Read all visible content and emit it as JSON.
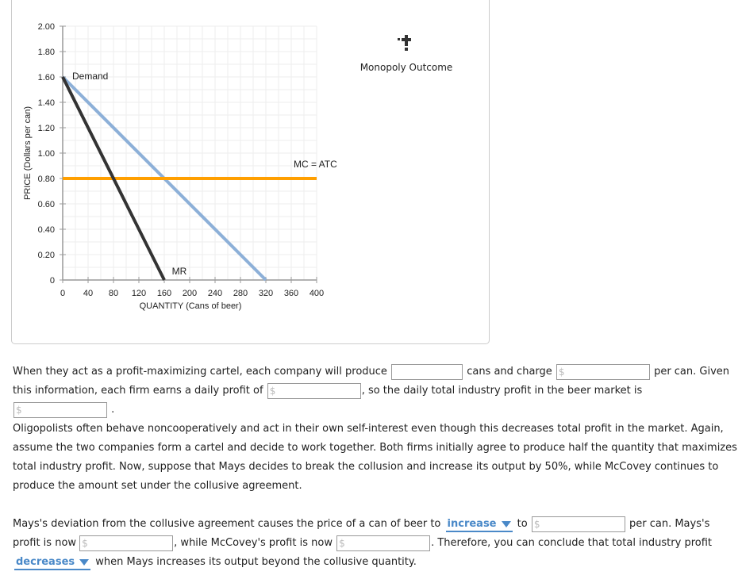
{
  "chart_data": {
    "type": "line",
    "xlabel": "QUANTITY (Cans of beer)",
    "ylabel": "PRICE (Dollars per can)",
    "xlim": [
      0,
      400
    ],
    "ylim": [
      0,
      2.0
    ],
    "xticks": [
      "0",
      "40",
      "80",
      "120",
      "160",
      "200",
      "240",
      "280",
      "320",
      "360",
      "400"
    ],
    "yticks": [
      "0",
      "0.20",
      "0.40",
      "0.60",
      "0.80",
      "1.00",
      "1.20",
      "1.40",
      "1.60",
      "1.80",
      "2.00"
    ],
    "grid": true,
    "series": [
      {
        "name": "Demand",
        "color": "#8db0d8",
        "points": [
          [
            0,
            1.6
          ],
          [
            320,
            0
          ]
        ]
      },
      {
        "name": "MR",
        "color": "#333333",
        "points": [
          [
            0,
            1.6
          ],
          [
            160,
            0
          ]
        ]
      },
      {
        "name": "MC = ATC",
        "color": "#ff9f00",
        "points": [
          [
            0,
            0.8
          ],
          [
            400,
            0.8
          ]
        ]
      }
    ],
    "legend": {
      "label": "Monopoly Outcome",
      "icon": "plus-marker-icon",
      "placement": "right"
    }
  },
  "q1": {
    "t1": "When they act as a profit-maximizing cartel, each company will produce",
    "t2": "cans and charge",
    "t3": "per can. Given this information, each firm earns a daily profit of",
    "t4": ", so the daily total industry profit in the beer market is",
    "t5": ".",
    "dollar": "$"
  },
  "q2": "Oligopolists often behave noncooperatively and act in their own self-interest even though this decreases total profit in the market. Again, assume the two companies form a cartel and decide to work together. Both firms initially agree to produce half the quantity that maximizes total industry profit. Now, suppose that Mays decides to break the collusion and increase its output by 50%, while McCovey continues to produce the amount set under the collusive agreement.",
  "q3": {
    "t1": "Mays's deviation from the collusive agreement causes the price of a can of beer to",
    "sel1": "increase",
    "t2": "to",
    "t3": "per can. Mays's profit is now",
    "t4": ", while McCovey's profit is now",
    "t5": ". Therefore, you can conclude that total industry profit",
    "sel2": "decreases",
    "t6": "when Mays increases its output beyond the collusive quantity.",
    "dollar": "$"
  }
}
